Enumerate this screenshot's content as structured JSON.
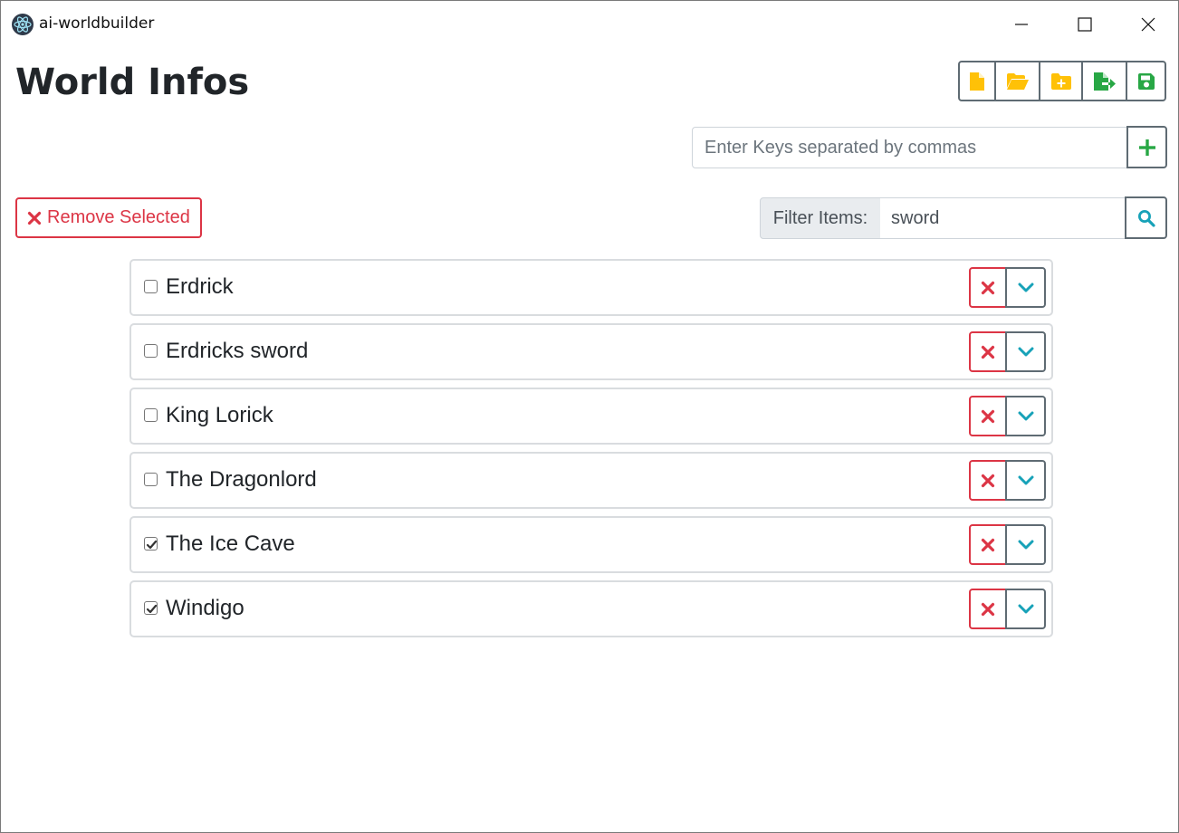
{
  "app": {
    "title": "ai-worldbuilder",
    "icon": "electron-atom-icon"
  },
  "window_controls": {
    "minimize_icon": "minimize-icon",
    "maximize_icon": "maximize-icon",
    "close_icon": "close-icon"
  },
  "page": {
    "title": "World Infos"
  },
  "toolbar": {
    "buttons": [
      {
        "name": "new-file",
        "icon": "file-icon",
        "color": "#ffc107"
      },
      {
        "name": "open-folder",
        "icon": "folder-open-icon",
        "color": "#ffc107"
      },
      {
        "name": "new-folder",
        "icon": "folder-plus-icon",
        "color": "#ffc107"
      },
      {
        "name": "export-file",
        "icon": "file-export-icon",
        "color": "#28a745"
      },
      {
        "name": "save",
        "icon": "save-icon",
        "color": "#28a745"
      }
    ]
  },
  "keys_input": {
    "placeholder": "Enter Keys separated by commas",
    "value": "",
    "add_icon": "plus-icon"
  },
  "actions": {
    "remove_selected_label": "Remove Selected",
    "remove_icon": "times-icon"
  },
  "filter": {
    "label": "Filter Items:",
    "value": "sword",
    "search_icon": "search-icon"
  },
  "items": [
    {
      "label": "Erdrick",
      "checked": false
    },
    {
      "label": "Erdricks sword",
      "checked": false
    },
    {
      "label": "King Lorick",
      "checked": false
    },
    {
      "label": "The Dragonlord",
      "checked": false
    },
    {
      "label": "The Ice Cave",
      "checked": true
    },
    {
      "label": "Windigo",
      "checked": true
    }
  ],
  "colors": {
    "danger": "#dc3545",
    "info": "#17a2b8",
    "success": "#28a745",
    "warning": "#ffc107",
    "secondary_border": "#5f6b73"
  }
}
